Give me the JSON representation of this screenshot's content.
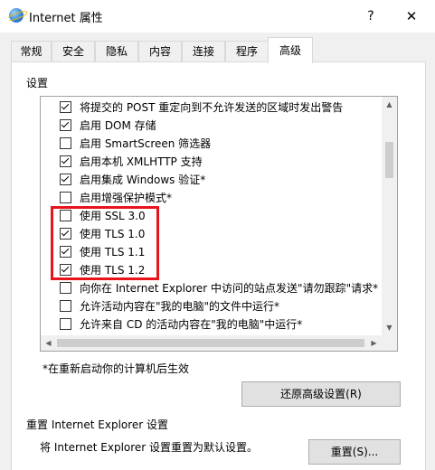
{
  "window": {
    "title": "Internet 属性",
    "help": "?",
    "close": "✕"
  },
  "tabs": [
    "常规",
    "安全",
    "隐私",
    "内容",
    "连接",
    "程序",
    "高级"
  ],
  "settings_label": "设置",
  "options": [
    {
      "label": "将提交的 POST 重定向到不允许发送的区域时发出警告",
      "checked": true
    },
    {
      "label": "启用 DOM 存储",
      "checked": true
    },
    {
      "label": "启用 SmartScreen 筛选器",
      "checked": false
    },
    {
      "label": "启用本机 XMLHTTP 支持",
      "checked": true
    },
    {
      "label": "启用集成 Windows 验证*",
      "checked": true
    },
    {
      "label": "启用增强保护模式*",
      "checked": false
    },
    {
      "label": "使用 SSL 3.0",
      "checked": false
    },
    {
      "label": "使用 TLS 1.0",
      "checked": true
    },
    {
      "label": "使用 TLS 1.1",
      "checked": true
    },
    {
      "label": "使用 TLS 1.2",
      "checked": true
    },
    {
      "label": "向你在 Internet Explorer 中访问的站点发送\"请勿跟踪\"请求*",
      "checked": false
    },
    {
      "label": "允许活动内容在\"我的电脑\"的文件中运行*",
      "checked": false
    },
    {
      "label": "允许来自 CD 的活动内容在\"我的电脑\"中运行*",
      "checked": false
    }
  ],
  "restart_note": "*在重新启动你的计算机后生效",
  "restore_button": "还原高级设置(R)",
  "reset_group_label": "重置 Internet Explorer 设置",
  "reset_description": "将 Internet Explorer 设置重置为默认设置。",
  "reset_button": "重置(S)..."
}
